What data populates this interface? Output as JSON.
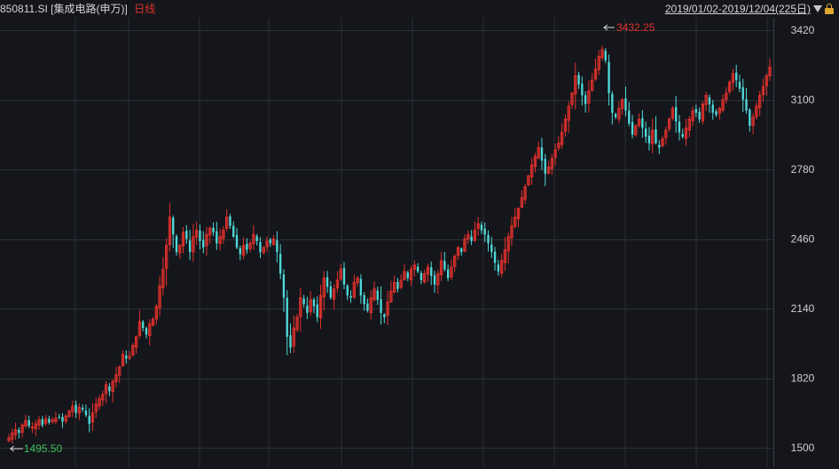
{
  "header": {
    "code": "850811.SI",
    "name": "[集成电路(申万)]",
    "period": "日线",
    "range": "2019/01/02-2019/12/04(225日)"
  },
  "chart_data": {
    "type": "candlestick",
    "y_ticks": [
      "3420",
      "3100",
      "2780",
      "2460",
      "2140",
      "1820",
      "1500"
    ],
    "ylim": [
      1460,
      3510
    ],
    "grid": true,
    "up_color": "#e2312c",
    "down_color": "#4fd9d9",
    "high_label": "3432.25",
    "low_label": "1495.50",
    "high_value": 3432.25,
    "low_value": 1495.5,
    "closes": [
      1545,
      1568,
      1583,
      1568,
      1605,
      1625,
      1600,
      1595,
      1610,
      1628,
      1604,
      1632,
      1616,
      1628,
      1635,
      1640,
      1620,
      1645,
      1668,
      1690,
      1660,
      1685,
      1675,
      1650,
      1610,
      1660,
      1700,
      1725,
      1745,
      1790,
      1760,
      1805,
      1835,
      1870,
      1930,
      1910,
      1920,
      1970,
      2010,
      2080,
      2050,
      2020,
      2070,
      2090,
      2150,
      2245,
      2320,
      2430,
      2560,
      2480,
      2400,
      2430,
      2490,
      2460,
      2400,
      2470,
      2500,
      2450,
      2420,
      2480,
      2510,
      2490,
      2440,
      2470,
      2500,
      2560,
      2520,
      2470,
      2420,
      2390,
      2430,
      2410,
      2440,
      2480,
      2450,
      2400,
      2420,
      2450,
      2440,
      2460,
      2400,
      2300,
      2190,
      2010,
      1960,
      2050,
      2100,
      2190,
      2160,
      2120,
      2180,
      2150,
      2100,
      2200,
      2280,
      2240,
      2190,
      2230,
      2270,
      2320,
      2250,
      2200,
      2190,
      2260,
      2280,
      2200,
      2160,
      2130,
      2190,
      2230,
      2180,
      2120,
      2100,
      2170,
      2220,
      2260,
      2230,
      2270,
      2310,
      2280,
      2320,
      2340,
      2310,
      2270,
      2300,
      2330,
      2290,
      2250,
      2300,
      2360,
      2320,
      2280,
      2330,
      2380,
      2420,
      2400,
      2460,
      2480,
      2450,
      2500,
      2530,
      2500,
      2480,
      2440,
      2400,
      2350,
      2310,
      2360,
      2410,
      2470,
      2520,
      2560,
      2600,
      2650,
      2700,
      2750,
      2800,
      2840,
      2880,
      2820,
      2760,
      2790,
      2830,
      2870,
      2900,
      2950,
      3010,
      3070,
      3130,
      3210,
      3170,
      3120,
      3080,
      3140,
      3190,
      3240,
      3300,
      3330,
      3280,
      3130,
      3040,
      3020,
      3060,
      3100,
      3050,
      2990,
      2940,
      2980,
      3010,
      2970,
      2930,
      2900,
      2960,
      2900,
      2880,
      2920,
      2960,
      3010,
      3060,
      3000,
      2950,
      2930,
      2970,
      3010,
      3050,
      3040,
      3010,
      3080,
      3120,
      3080,
      3040,
      3030,
      3060,
      3100,
      3130,
      3180,
      3220,
      3190,
      3150,
      3100,
      3050,
      2980,
      3020,
      3070,
      3120,
      3160,
      3210,
      3250
    ]
  }
}
